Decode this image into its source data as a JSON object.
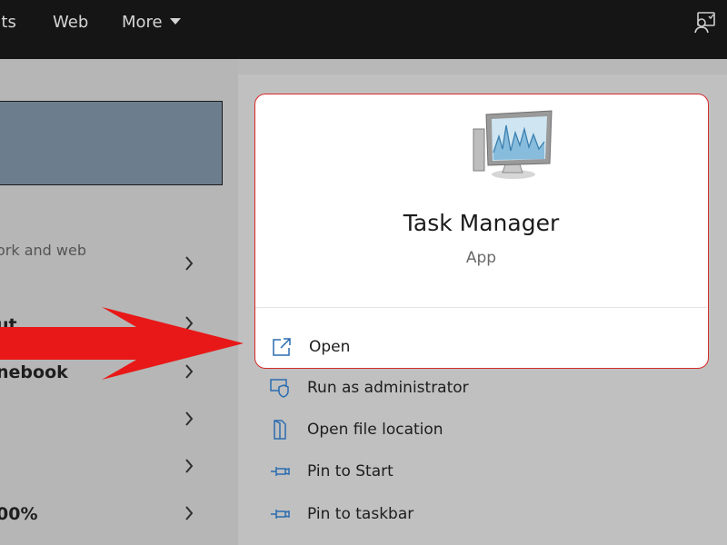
{
  "topbar": {
    "tabs": [
      {
        "label": "nts"
      },
      {
        "label": "Web"
      },
      {
        "label": "More"
      }
    ],
    "feedback_icon": "feedback-icon"
  },
  "left_pane": {
    "search_web_text": "ork and web",
    "results": [
      {
        "label": "ut"
      },
      {
        "label": "nebook"
      },
      {
        "label": "00%"
      }
    ],
    "chevron_icon": "chevron-right-icon"
  },
  "app_card": {
    "name": "Task Manager",
    "type": "App",
    "icon": "task-manager-icon",
    "accent": "#d82828"
  },
  "actions": [
    {
      "label": "Open",
      "icon": "open-icon"
    },
    {
      "label": "Run as administrator",
      "icon": "shield-icon"
    },
    {
      "label": "Open file location",
      "icon": "folder-icon"
    },
    {
      "label": "Pin to Start",
      "icon": "pin-icon"
    },
    {
      "label": "Pin to taskbar",
      "icon": "pin-icon"
    }
  ],
  "annotation": {
    "icon": "red-arrow-icon",
    "color": "#e81818"
  }
}
